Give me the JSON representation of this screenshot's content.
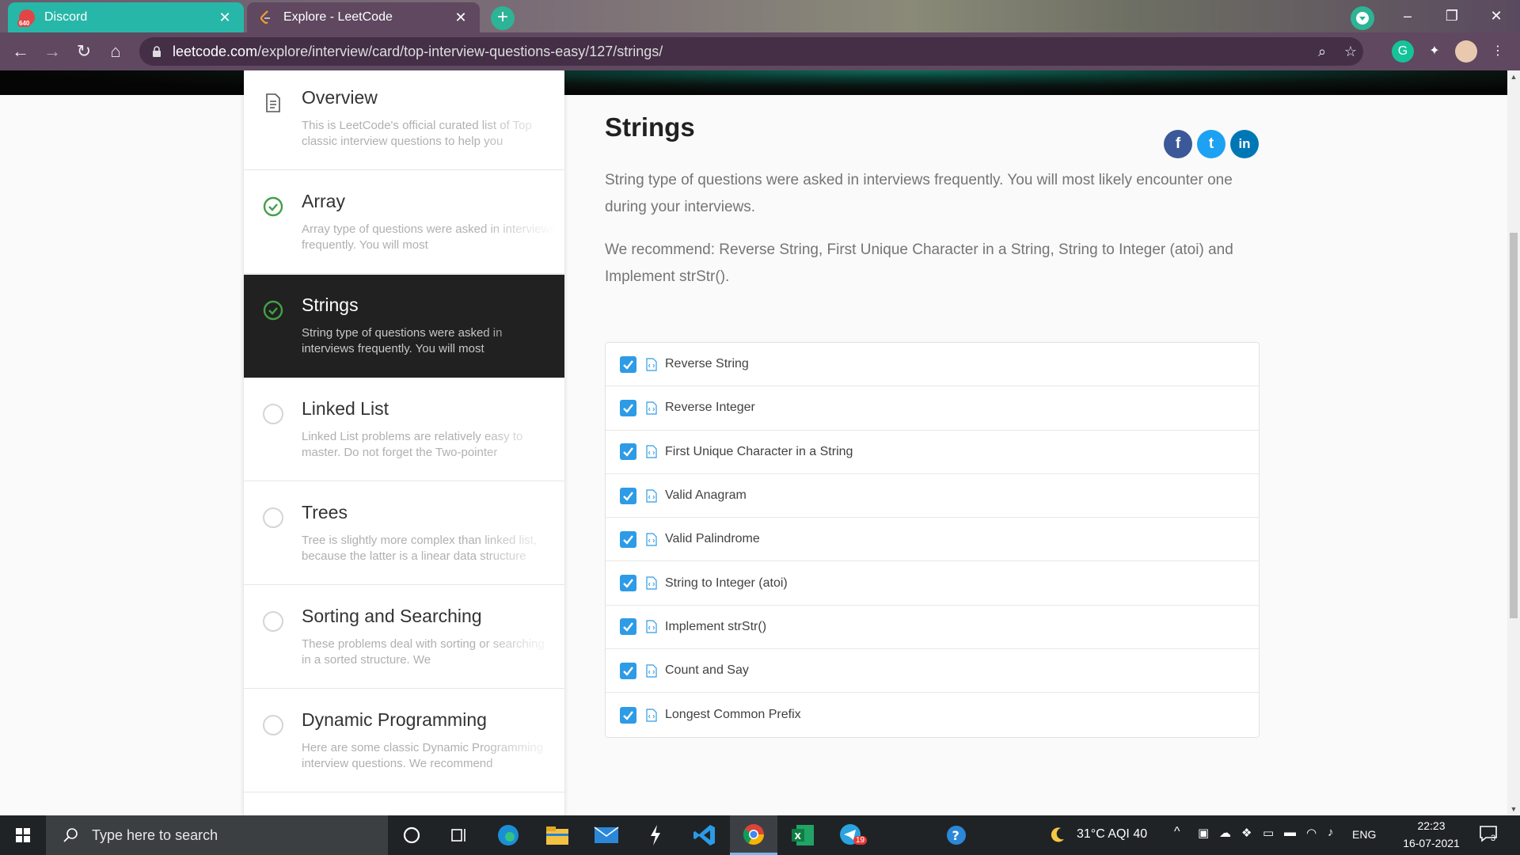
{
  "browser": {
    "tabs": [
      {
        "title": "Discord",
        "badge": "640",
        "close": "✕"
      },
      {
        "title": "Explore - LeetCode",
        "close": "✕"
      }
    ],
    "new_tab": "+",
    "url_host": "leetcode.com",
    "url_path": "/explore/interview/card/top-interview-questions-easy/127/strings/",
    "window_controls": [
      "–",
      "❐",
      "✕"
    ],
    "accent_color": "#5f4860"
  },
  "sidebar": {
    "chapters": [
      {
        "title": "Overview",
        "desc": "This is LeetCode's official curated list of Top classic interview questions to help you",
        "status": "document-icon"
      },
      {
        "title": "Array",
        "desc": "Array type of questions were asked in interviews frequently. You will most",
        "status": "check-circle-icon"
      },
      {
        "title": "Strings",
        "desc": "String type of questions were asked in interviews frequently. You will most",
        "status": "check-circle-icon",
        "active": true
      },
      {
        "title": "Linked List",
        "desc": "Linked List problems are relatively easy to master. Do not forget the Two-pointer",
        "status": "empty-circle-icon"
      },
      {
        "title": "Trees",
        "desc": "Tree is slightly more complex than linked list, because the latter is a linear data structure",
        "status": "empty-circle-icon"
      },
      {
        "title": "Sorting and Searching",
        "desc": "These problems deal with sorting or searching in a sorted structure. We",
        "status": "empty-circle-icon"
      },
      {
        "title": "Dynamic Programming",
        "desc": "Here are some classic Dynamic Programming interview questions. We recommend",
        "status": "empty-circle-icon"
      }
    ]
  },
  "main": {
    "title": "Strings",
    "share": {
      "facebook": "f",
      "twitter": "t",
      "linkedin": "in"
    },
    "intro": "String type of questions were asked in interviews frequently. You will most likely encounter one during your interviews.",
    "recommend": "We recommend: Reverse String, First Unique Character in a String, String to Integer (atoi) and Implement strStr().",
    "questions": [
      "Reverse String",
      "Reverse Integer",
      "First Unique Character in a String",
      "Valid Anagram",
      "Valid Palindrome",
      "String to Integer (atoi)",
      "Implement strStr()",
      "Count and Say",
      "Longest Common Prefix"
    ]
  },
  "taskbar": {
    "search_placeholder": "Type here to search",
    "weather": "31°C  AQI 40",
    "language": "ENG",
    "time": "22:23",
    "date": "16-07-2021",
    "notification_count": "3",
    "telegram_badge": "19"
  }
}
